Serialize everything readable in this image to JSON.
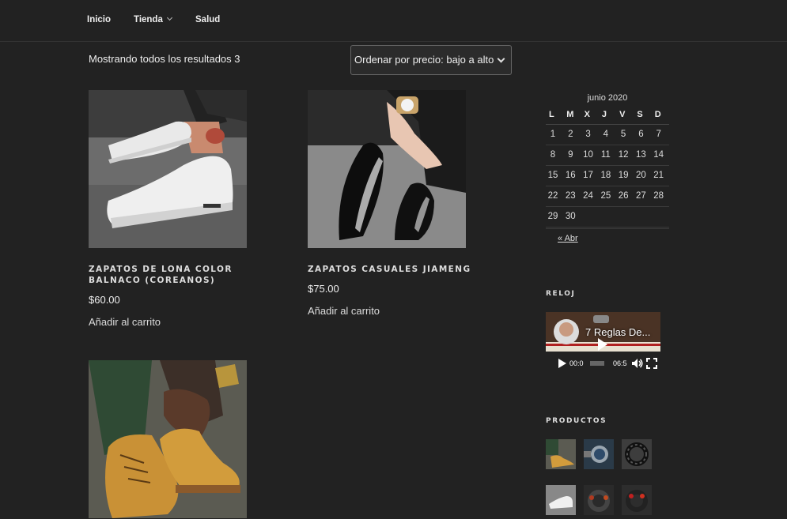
{
  "nav": {
    "items": [
      {
        "label": "Inicio"
      },
      {
        "label": "Tienda",
        "has_dropdown": true
      },
      {
        "label": "Salud"
      }
    ]
  },
  "shop": {
    "results_text": "Mostrando todos los resultados 3",
    "sort_selected": "Ordenar por precio: bajo a alto"
  },
  "products": [
    {
      "title": "ZAPATOS DE LONA COLOR BALNACO (COREANOS)",
      "price": "$60.00",
      "cart": "Añadir al carrito",
      "image": "white-sneaker-photo"
    },
    {
      "title": "ZAPATOS CASUALES JIAMENG",
      "price": "$75.00",
      "cart": "Añadir al carrito",
      "image": "black-dress-shoe-photo"
    },
    {
      "title": "",
      "price": "",
      "cart": "",
      "image": "yellow-boot-photo"
    }
  ],
  "calendar": {
    "caption": "junio 2020",
    "weekdays": [
      "L",
      "M",
      "X",
      "J",
      "V",
      "S",
      "D"
    ],
    "weeks": [
      [
        "1",
        "2",
        "3",
        "4",
        "5",
        "6",
        "7"
      ],
      [
        "8",
        "9",
        "10",
        "11",
        "12",
        "13",
        "14"
      ],
      [
        "15",
        "16",
        "17",
        "18",
        "19",
        "20",
        "21"
      ],
      [
        "22",
        "23",
        "24",
        "25",
        "26",
        "27",
        "28"
      ],
      [
        "29",
        "30",
        "",
        "",
        "",
        "",
        ""
      ]
    ],
    "prev_link": "« Abr"
  },
  "widgets": {
    "reloj_title": "RELOJ",
    "video_title": "7 Reglas De...",
    "video_time_current": "00:0",
    "video_time_total": "06:5",
    "productos_title": "PRODUCTOS"
  },
  "colors": {
    "background": "#222222",
    "text": "#eeeeee",
    "border": "#666666"
  }
}
